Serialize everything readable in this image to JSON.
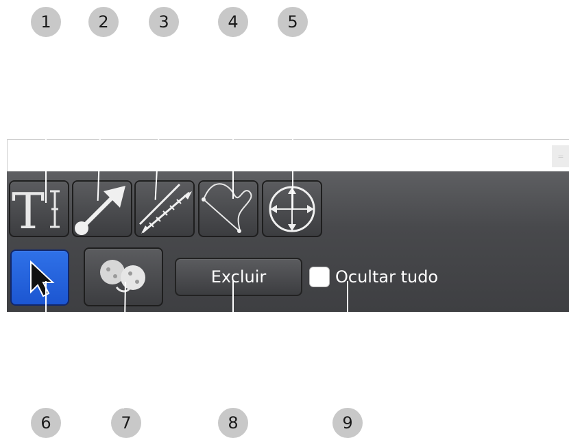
{
  "callouts": [
    "1",
    "2",
    "3",
    "4",
    "5",
    "6",
    "7",
    "8",
    "9"
  ],
  "toolbar": {
    "tools": [
      {
        "name": "text-tool",
        "icon": "text-icon"
      },
      {
        "name": "arrow-tool",
        "icon": "arrow-icon"
      },
      {
        "name": "ruler-tool",
        "icon": "ruler-icon"
      },
      {
        "name": "freehand-tool",
        "icon": "freehand-curve-icon"
      },
      {
        "name": "crosshair-tool",
        "icon": "crosshair-icon"
      }
    ],
    "select_icon": "cursor-arrow-icon",
    "compare_icon": "compare-circles-icon",
    "delete_label": "Excluir",
    "hide_all_label": "Ocultar tudo",
    "hide_all_checked": false
  },
  "colors": {
    "toolbar_bg": "#48494c",
    "active_blue": "#2f71e8",
    "callout_bg": "#c8c8c8"
  }
}
